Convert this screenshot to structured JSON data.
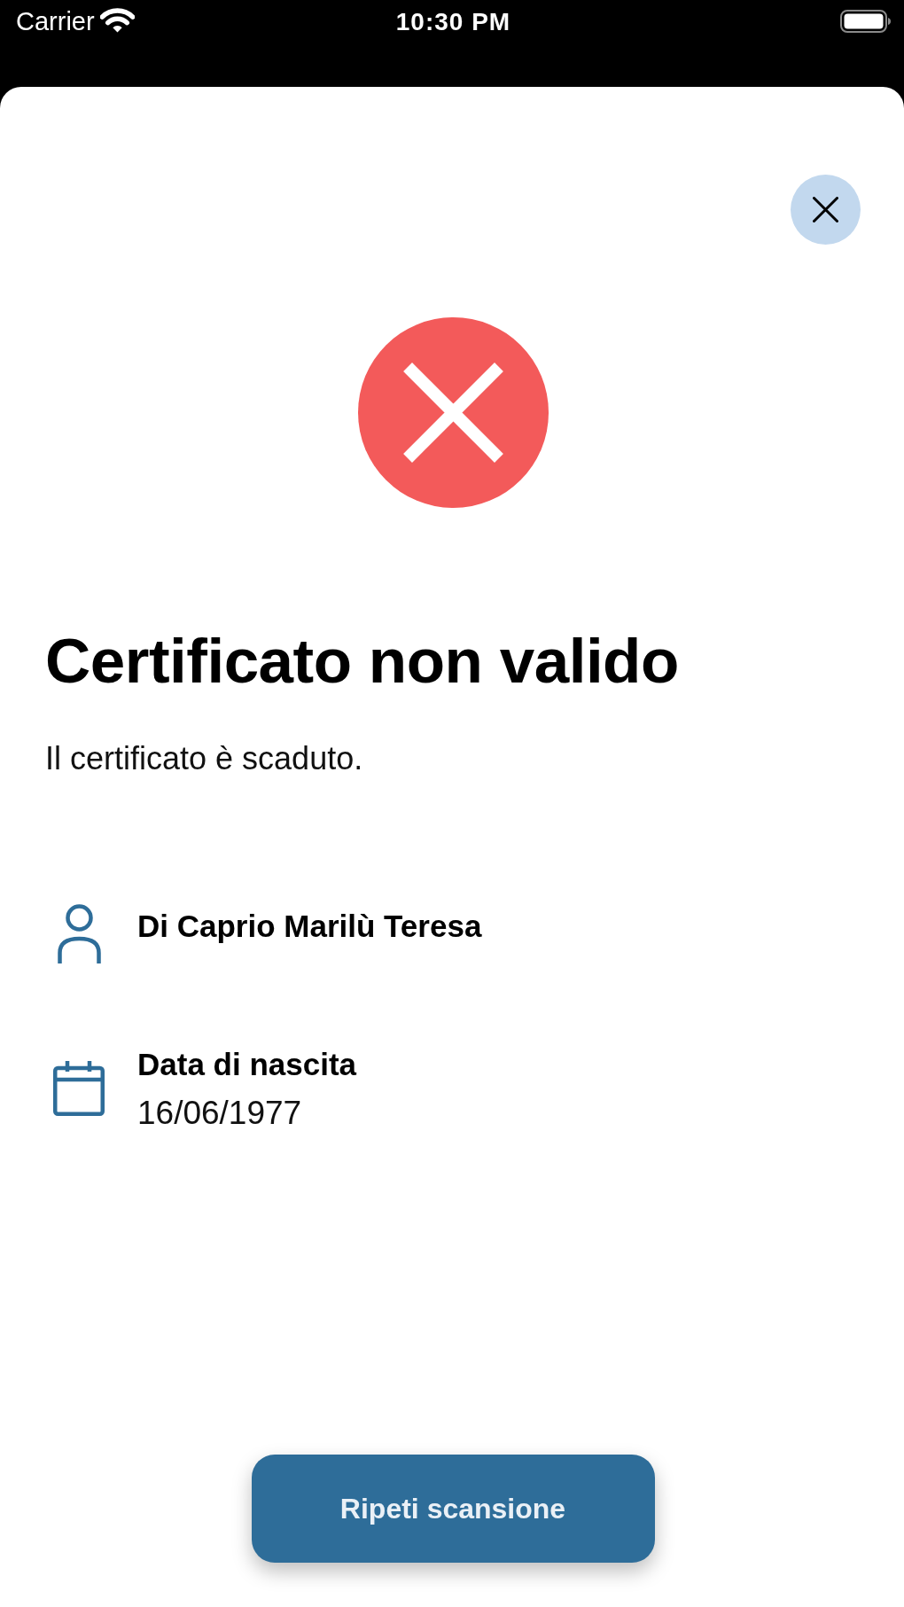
{
  "status_bar": {
    "carrier": "Carrier",
    "time": "10:30 PM"
  },
  "result": {
    "valid": false,
    "title": "Certificato non valido",
    "message": "Il certificato è scaduto."
  },
  "details": [
    {
      "kind": "person",
      "title": "Di Caprio Marilù Teresa"
    },
    {
      "kind": "birth_date",
      "title": "Data di nascita",
      "value": "16/06/1977"
    }
  ],
  "primary_button": {
    "label": "Ripeti scansione"
  }
}
